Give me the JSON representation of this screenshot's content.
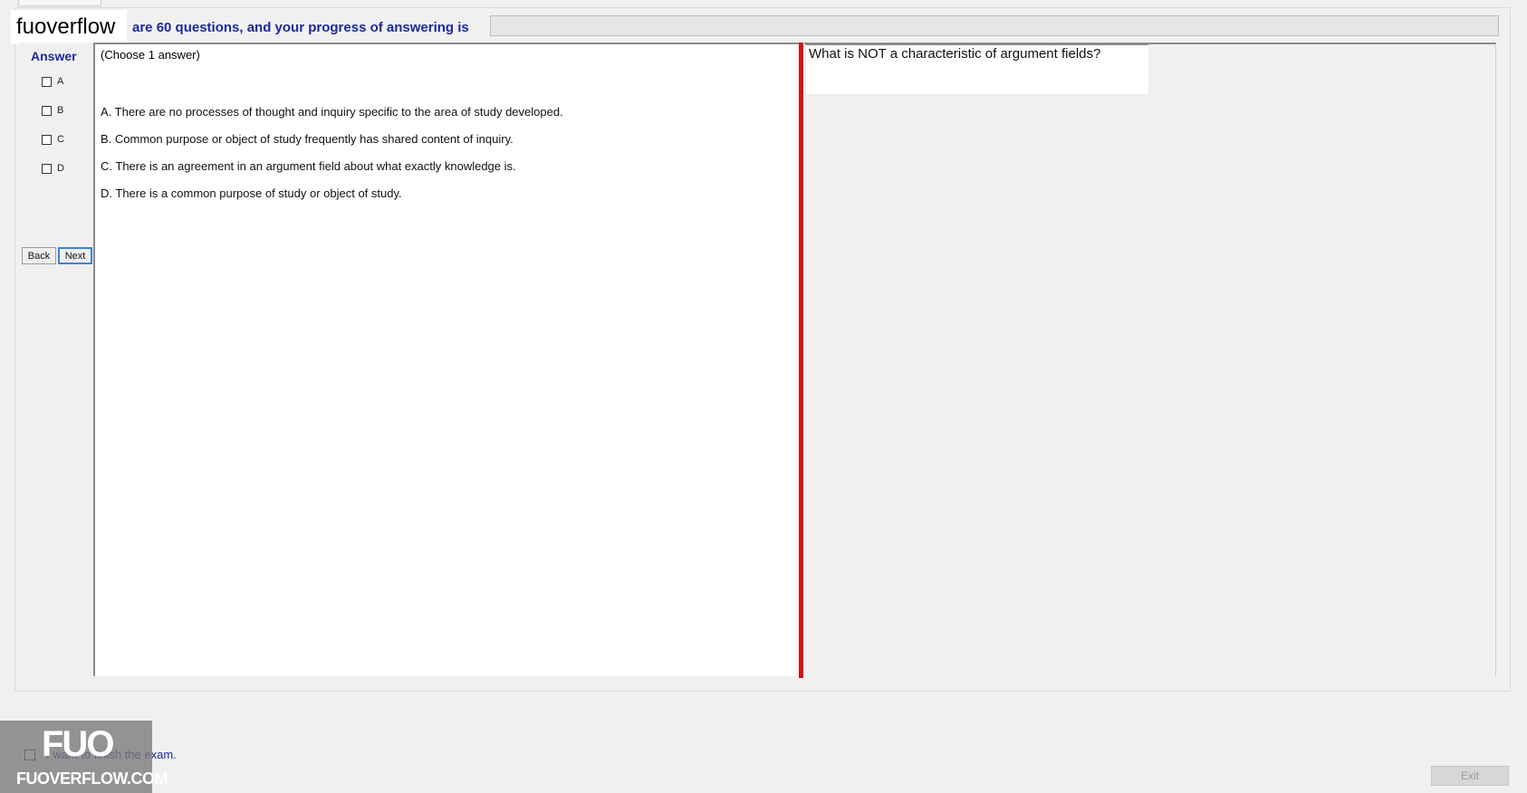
{
  "header": {
    "progress_text": "are 60 questions, and your progress of answering is",
    "logo_text": "fuoverflow"
  },
  "answer_panel": {
    "title": "Answer",
    "options": [
      "A",
      "B",
      "C",
      "D"
    ],
    "back_label": "Back",
    "next_label": "Next"
  },
  "question_panel": {
    "choose_text": "(Choose 1 answer)",
    "options": [
      "A.  There are no processes of thought and inquiry specific to the area of study developed.",
      "B.  Common purpose or object of study frequently has shared content of inquiry.",
      "C.  There is an agreement in an argument field about what exactly knowledge is.",
      "D.  There is a common purpose of study or object of study."
    ]
  },
  "question": {
    "text": "What is NOT a characteristic of argument fields?"
  },
  "footer": {
    "finish_text": "I want to finish the exam.",
    "exit_label": "Exit"
  },
  "watermark": {
    "logo": "FUO",
    "site": "FUOVERFLOW.COM"
  },
  "colors": {
    "header_text": "#1c2a9c",
    "divider": "#d3120f",
    "background": "#f0f0f0"
  }
}
